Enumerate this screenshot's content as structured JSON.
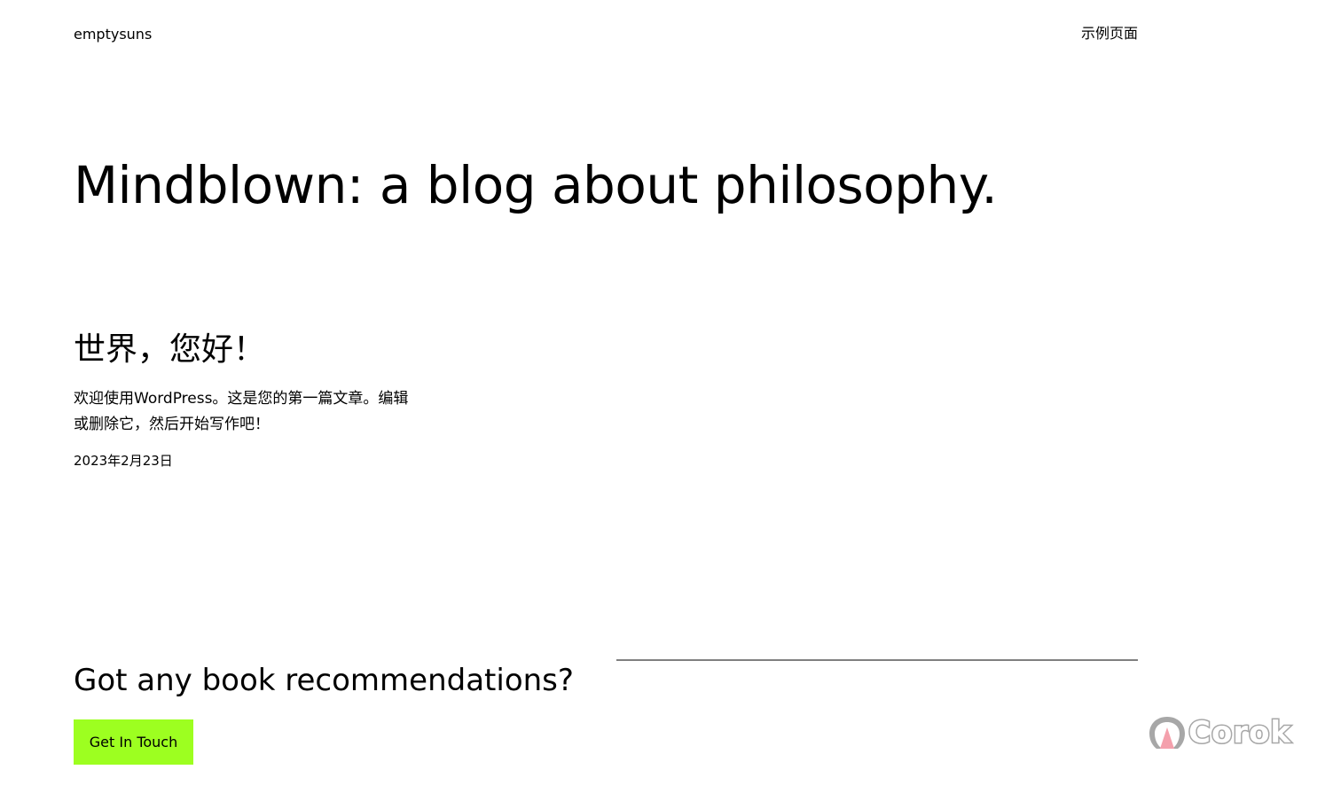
{
  "header": {
    "site_title": "emptysuns",
    "nav": {
      "sample_page": "示例页面"
    }
  },
  "hero": {
    "tagline": "Mindblown: a blog about philosophy."
  },
  "post": {
    "title": "世界，您好！",
    "excerpt": "欢迎使用WordPress。这是您的第一篇文章。编辑或删除它，然后开始写作吧！",
    "date": "2023年2月23日"
  },
  "cta": {
    "heading": "Got any book recommendations?",
    "button_label": "Get In Touch",
    "button_color": "#9dff20"
  },
  "watermark": {
    "text": "Corok",
    "icon": "corok-logo-icon"
  }
}
